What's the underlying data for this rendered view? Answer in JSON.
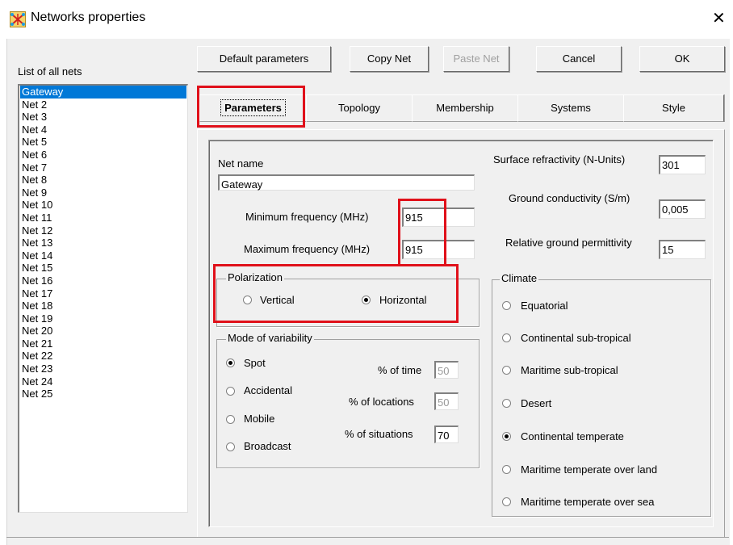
{
  "window": {
    "title": "Networks properties",
    "close_glyph": "✕",
    "icon": "network-app-icon"
  },
  "list": {
    "label": "List of all nets",
    "items": [
      "Gateway",
      "Net 2",
      "Net 3",
      "Net 4",
      "Net 5",
      "Net 6",
      "Net 7",
      "Net 8",
      "Net 9",
      "Net 10",
      "Net 11",
      "Net 12",
      "Net 13",
      "Net 14",
      "Net 15",
      "Net 16",
      "Net 17",
      "Net 18",
      "Net 19",
      "Net 20",
      "Net 21",
      "Net 22",
      "Net 23",
      "Net 24",
      "Net 25"
    ],
    "selected": "Gateway"
  },
  "toolbar": {
    "default_label": "Default parameters",
    "copy_label": "Copy Net",
    "paste_label": "Paste Net",
    "cancel_label": "Cancel",
    "ok_label": "OK"
  },
  "tabs": {
    "parameters": "Parameters",
    "topology": "Topology",
    "membership": "Membership",
    "systems": "Systems",
    "style": "Style",
    "active": "Parameters"
  },
  "params": {
    "net_name_label": "Net name",
    "net_name_value": "Gateway",
    "min_freq_label": "Minimum frequency (MHz)",
    "min_freq_value": "915",
    "max_freq_label": "Maximum frequency (MHz)",
    "max_freq_value": "915",
    "surface_label": "Surface refractivity (N-Units)",
    "surface_value": "301",
    "ground_cond_label": "Ground conductivity (S/m)",
    "ground_cond_value": "0,005",
    "ground_perm_label": "Relative ground permittivity",
    "ground_perm_value": "15"
  },
  "polarization": {
    "title": "Polarization",
    "vertical": "Vertical",
    "horizontal": "Horizontal",
    "selected": "Horizontal"
  },
  "variability": {
    "title": "Mode of variability",
    "spot": "Spot",
    "accidental": "Accidental",
    "mobile": "Mobile",
    "broadcast": "Broadcast",
    "selected": "Spot",
    "time_label": "% of time",
    "time_value": "50",
    "locations_label": "% of locations",
    "locations_value": "50",
    "situations_label": "% of situations",
    "situations_value": "70"
  },
  "climate": {
    "title": "Climate",
    "options": [
      "Equatorial",
      "Continental sub-tropical",
      "Maritime sub-tropical",
      "Desert",
      "Continental temperate",
      "Maritime temperate over land",
      "Maritime temperate over sea"
    ],
    "selected": "Continental temperate"
  },
  "colors": {
    "selection": "#0078d7",
    "highlight_box": "#e0101a",
    "dialog_bg": "#f0f0f0"
  }
}
